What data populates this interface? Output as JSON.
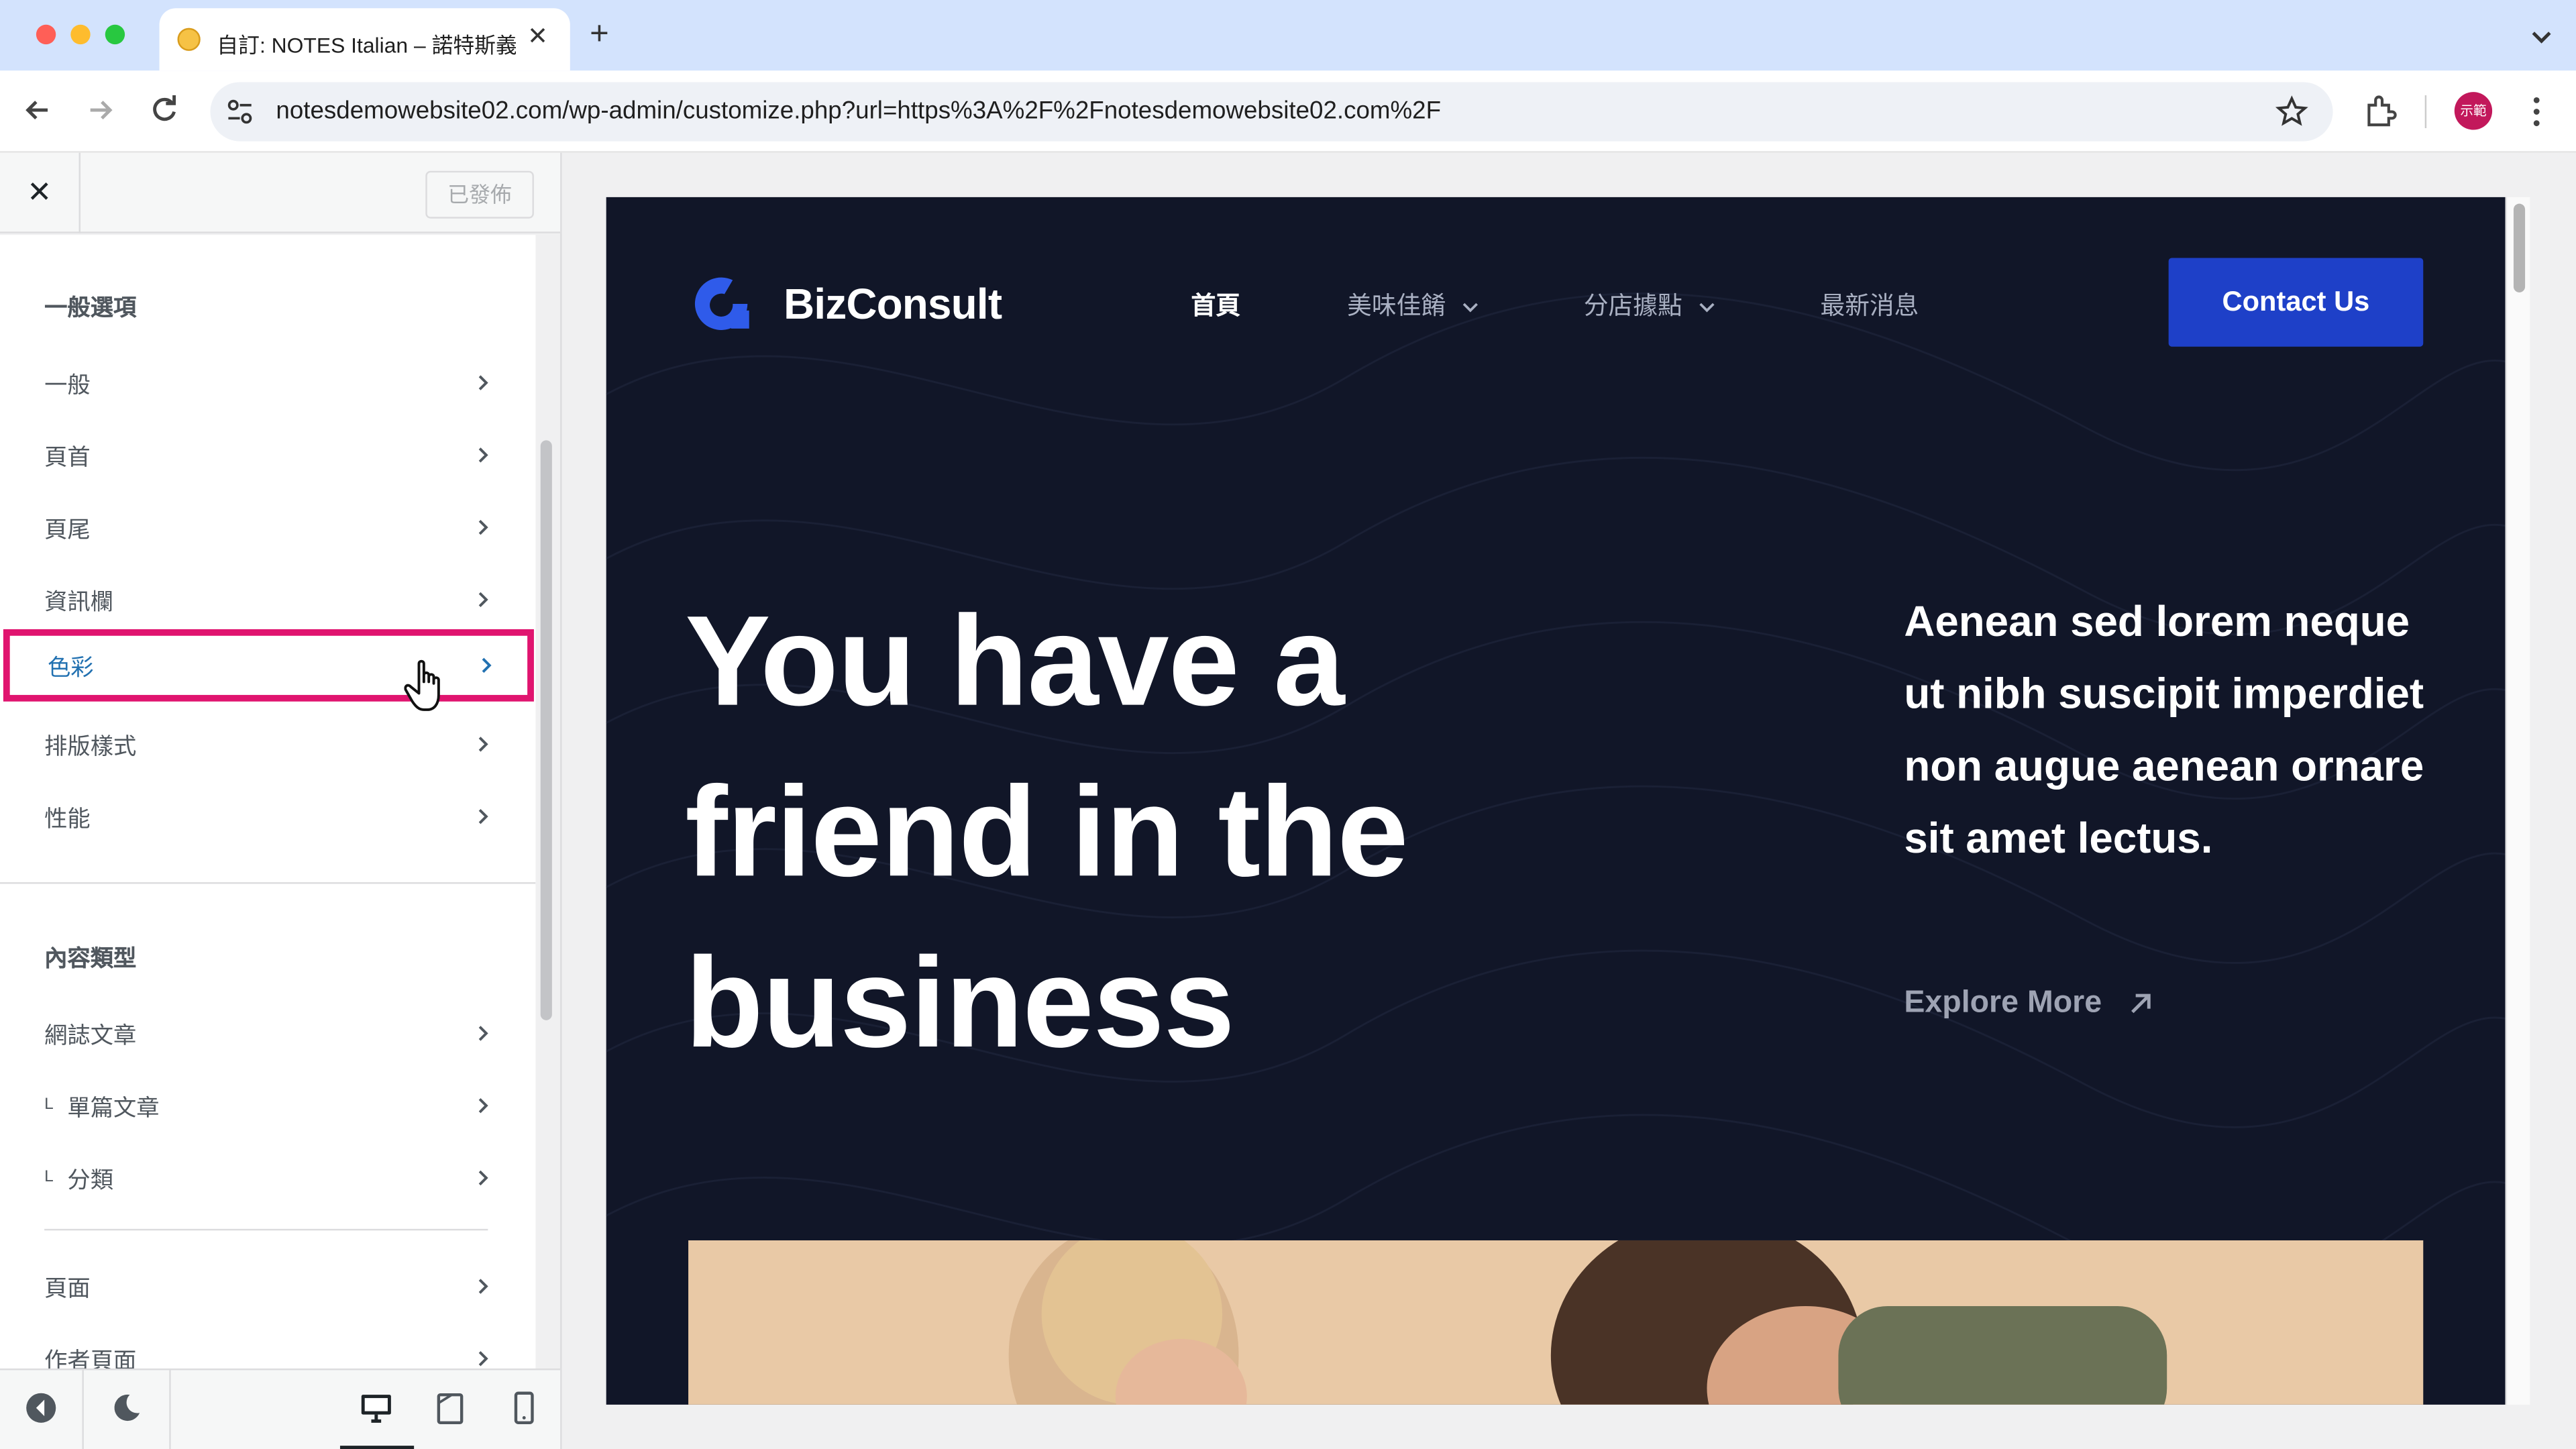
{
  "browser": {
    "tab_title": "自訂: NOTES Italian – 諾特斯義",
    "tab_close": "✕",
    "new_tab": "+",
    "url": "notesdemowebsite02.com/wp-admin/customize.php?url=https%3A%2F%2Fnotesdemowebsite02.com%2F",
    "profile_label": "示範",
    "colors": {
      "tabbar": "#d3e3fd",
      "close_light": "#ff5f57",
      "min_light": "#febc2e",
      "max_light": "#28c840"
    }
  },
  "customizer": {
    "close": "✕",
    "publish_label": "已發佈",
    "general_title": "一般選項",
    "general_items": [
      "一般",
      "頁首",
      "頁尾",
      "資訊欄",
      "色彩",
      "排版樣式",
      "性能"
    ],
    "active_item": "色彩",
    "content_title": "內容類型",
    "content_items": [
      "網誌文章",
      "單篇文章",
      "分類"
    ],
    "sub_marker": "L",
    "more_items": [
      "頁面",
      "作者頁面"
    ],
    "highlight_color": "#e0146f"
  },
  "preview": {
    "brand": "BizConsult",
    "nav": [
      "首頁",
      "美味佳餚",
      "分店據點",
      "最新消息"
    ],
    "contact": "Contact Us",
    "hero_lines": [
      "You have a",
      "friend in the",
      "business"
    ],
    "side_text": "Aenean sed lorem neque ut nibh suscipit imperdiet non augue aenean ornare sit amet lectus.",
    "explore": "Explore More",
    "colors": {
      "background": "#111628",
      "button": "#1e40c8"
    }
  }
}
